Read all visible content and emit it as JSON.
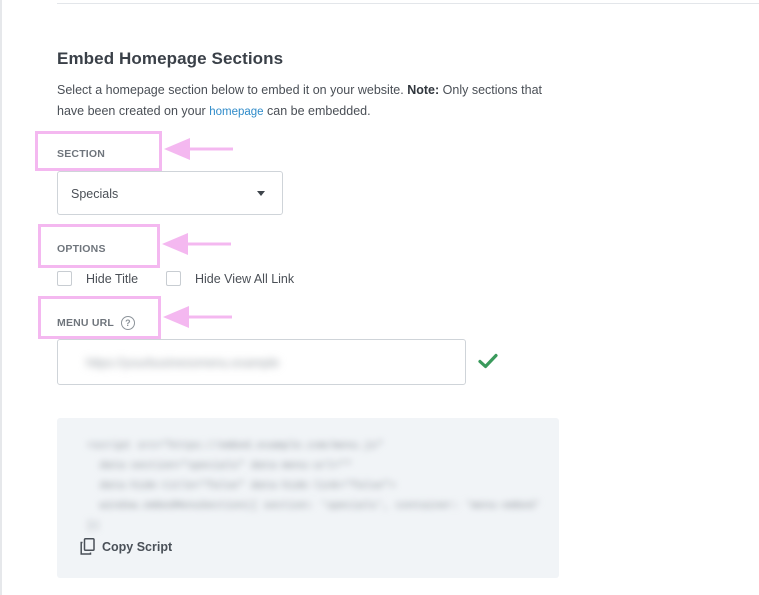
{
  "section": {
    "title": "Embed Homepage Sections",
    "description_pre": "Select a homepage section below to embed it on your website. ",
    "note_label": "Note:",
    "description_mid": " Only sections that have been created on your ",
    "homepage_link": "homepage",
    "description_post": " can be embedded."
  },
  "fields": {
    "section_label": "SECTION",
    "section_value": "Specials",
    "options_label": "OPTIONS",
    "hide_title_label": "Hide Title",
    "hide_view_all_label": "Hide View All Link",
    "menu_url_label": "MENU URL",
    "menu_url_help": "?",
    "menu_url_value": "https://yourbusinessmenu.example"
  },
  "code": {
    "script_text": "<script src=\"https://embed.example.com/menu.js\"\n  data-section=\"specials\" data-menu-url=\"\"\n  data-hide-title=\"false\" data-hide-link=\"false\">\n  window.embedMenuSection({ section: 'specials', container: 'menu-embed' })",
    "copy_label": "Copy Script"
  },
  "icons": {
    "section_caret": "chevron-down-icon",
    "help": "question-circle-icon",
    "valid": "check-icon",
    "copy": "copy-icon"
  },
  "colors": {
    "link": "#2f8bc9",
    "valid_check": "#3a9a5c",
    "annotation": "#f4b8f0"
  }
}
